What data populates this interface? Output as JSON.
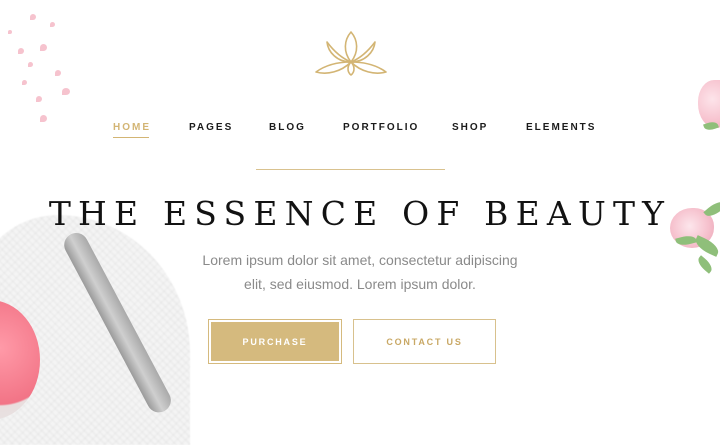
{
  "brand": {
    "logo_icon": "lotus-icon",
    "accent_color": "#d3b574"
  },
  "nav": {
    "items": [
      {
        "label": "HOME",
        "active": true
      },
      {
        "label": "PAGES",
        "active": false
      },
      {
        "label": "BLOG",
        "active": false
      },
      {
        "label": "PORTFOLIO",
        "active": false
      },
      {
        "label": "SHOP",
        "active": false
      },
      {
        "label": "ELEMENTS",
        "active": false
      }
    ]
  },
  "hero": {
    "title": "THE ESSENCE OF BEAUTY",
    "subtitle_line1": "Lorem ipsum dolor sit amet, consectetur adipiscing",
    "subtitle_line2": "elit, sed eiusmod. Lorem ipsum dolor.",
    "primary_button": "PURCHASE",
    "secondary_button": "CONTACT US"
  },
  "colors": {
    "gold": "#d5ba7e",
    "text_dark": "#121212",
    "text_muted": "#8a8a8a"
  }
}
